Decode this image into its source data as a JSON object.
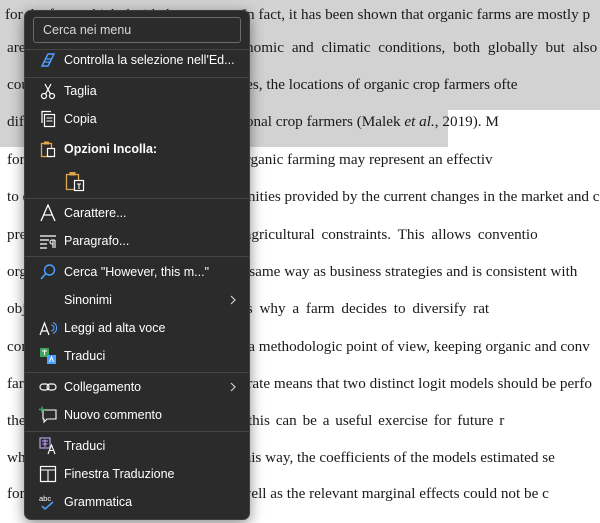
{
  "document": {
    "lines": [
      {
        "pre": "for the farm which decided to convert. In fact, it has been shown that organic farms are mostly p",
        "em": "",
        "post": ""
      },
      {
        "pre": "are found in areas with specific economic and climatic conditions, both globally but also",
        "em": "",
        "post": ""
      },
      {
        "pre": "countries, and across individual countries, the locations of organic crop farmers ofte",
        "em": "",
        "post": ""
      },
      {
        "pre": "different from the locations of conventional crop farmers (Malek ",
        "em": "et al.",
        "post": ", 2019). M"
      },
      {
        "pre": "for farmers who are the new entrants, organic farming may represent an effectiv",
        "em": "",
        "post": ""
      },
      {
        "pre": "to enter the sector thanks to the opportunities provided by the current changes in the market and co",
        "em": "",
        "post": ""
      },
      {
        "pre": "preferences, and to the relevance of agricultural constraints. This allows conventio",
        "em": "",
        "post": ""
      },
      {
        "pre": "organic farming to be considered in the same way as business strategies and is consistent with",
        "em": "",
        "post": ""
      },
      {
        "pre": "objective of understanding the reasons why a farm decides to diversify rat",
        "em": "",
        "post": ""
      },
      {
        "pre": "conventional farming. Otherwise, from a methodologic point of view, keeping organic and conv",
        "em": "",
        "post": ""
      },
      {
        "pre": "farms separate in order to estimate separate means that two distinct logit models should be perfo",
        "em": "",
        "post": ""
      },
      {
        "pre": "the one used in this model. Although this can be a useful exercise for future r",
        "em": "",
        "post": ""
      },
      {
        "pre": "why in this case we do not proceed in this way, the coefficients of the models estimated se",
        "em": "",
        "post": ""
      },
      {
        "pre": "for organic and conventional farms as well as the relevant marginal effects could not be c",
        "em": "",
        "post": ""
      }
    ]
  },
  "menu": {
    "search_placeholder": "Cerca nei menu",
    "items": [
      {
        "label": "Controlla la selezione nell'Ed...",
        "icon": "editor-check-icon"
      },
      {
        "label": "Taglia",
        "icon": "scissors-icon"
      },
      {
        "label": "Copia",
        "icon": "copy-icon"
      },
      {
        "label": "Opzioni Incolla:",
        "icon": "paste-icon"
      },
      {
        "label": "",
        "icon": "paste-keep-text-icon"
      },
      {
        "label": "Carattere...",
        "icon": "font-icon"
      },
      {
        "label": "Paragrafo...",
        "icon": "paragraph-icon"
      },
      {
        "label": "Cerca \"However, this m...\"",
        "icon": "search-icon"
      },
      {
        "label": "Sinonimi",
        "icon": ""
      },
      {
        "label": "Leggi ad alta voce",
        "icon": "read-aloud-icon"
      },
      {
        "label": "Traduci",
        "icon": "translate-icon"
      },
      {
        "label": "Collegamento",
        "icon": "link-icon"
      },
      {
        "label": "Nuovo commento",
        "icon": "new-comment-icon"
      },
      {
        "label": "Traduci",
        "icon": "translate-chinese-icon"
      },
      {
        "label": "Finestra Traduzione",
        "icon": "translation-window-icon"
      },
      {
        "label": "Grammatica",
        "icon": "grammar-icon"
      }
    ]
  },
  "colors": {
    "menu_bg": "#2b2b2b",
    "selection": "#d2d2d2",
    "accent_blue": "#4ea1ff",
    "paste_orange": "#e0a84a"
  }
}
